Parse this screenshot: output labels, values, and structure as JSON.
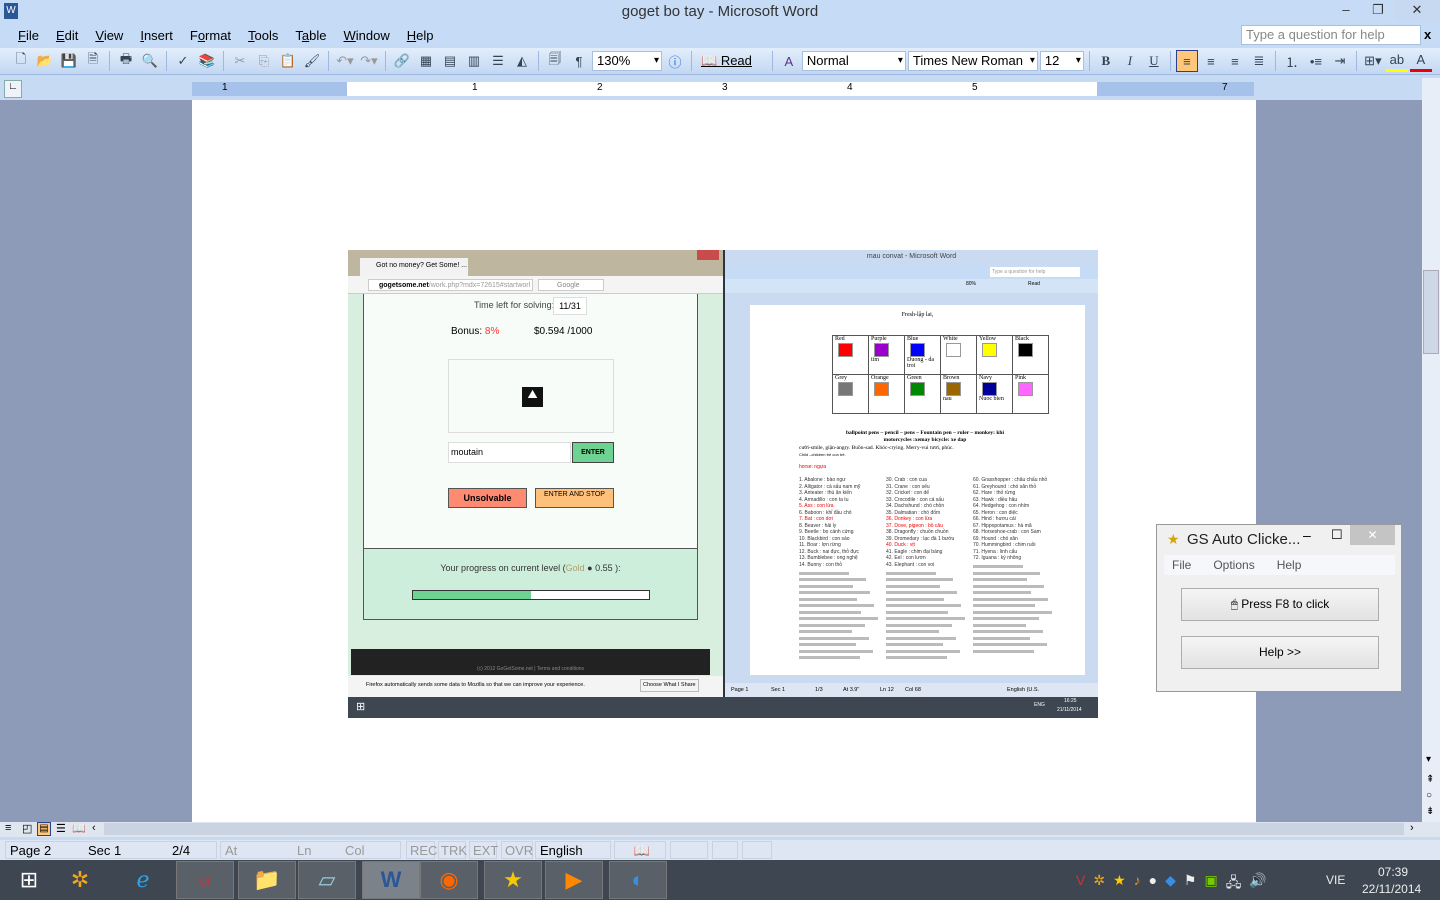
{
  "window": {
    "title": "goget bo tay - Microsoft Word",
    "help_placeholder": "Type a question for help",
    "close_doc": "x"
  },
  "menu": [
    {
      "key": "F",
      "rest": "ile"
    },
    {
      "key": "E",
      "rest": "dit"
    },
    {
      "key": "V",
      "rest": "iew"
    },
    {
      "key": "I",
      "rest": "nsert"
    },
    {
      "pre": "F",
      "key": "o",
      "rest": "rmat"
    },
    {
      "key": "T",
      "rest": "ools"
    },
    {
      "pre": "T",
      "key": "a",
      "rest": "ble"
    },
    {
      "key": "W",
      "rest": "indow"
    },
    {
      "key": "H",
      "rest": "elp"
    }
  ],
  "toolbar": {
    "zoom": "130%",
    "read": "Read",
    "style": "Normal",
    "font": "Times New Roman",
    "size": "12",
    "pilcrow": "¶"
  },
  "ruler": {
    "labels": [
      "1",
      "1",
      "2",
      "3",
      "4",
      "5",
      "7"
    ]
  },
  "status": {
    "page": "Page 2",
    "sec": "Sec 1",
    "pages": "2/4",
    "at": "At",
    "ln": "Ln",
    "col": "Col",
    "rec": "REC",
    "trk": "TRK",
    "ext": "EXT",
    "ovr": "OVR",
    "lang": "English (U.S."
  },
  "taskbar": {
    "lang": "VIE",
    "time": "07:39",
    "date": "22/11/2014",
    "apps": [
      "start-icon",
      "settings-app-icon",
      "internet-explorer-icon",
      "unikey-icon",
      "file-explorer-icon",
      "notepad-icon",
      "word-icon",
      "firefox-icon",
      "star-app-icon",
      "media-player-icon",
      "browser-globe-icon"
    ]
  },
  "embedded": {
    "firefox": {
      "tab": "Got no money? Get Some! ...",
      "url_host": "gogetsome.net",
      "url_path": "/work.php?mdx=72615#startworl",
      "search": "Google",
      "time_label": "Time left for solving:",
      "time_value": "11/31",
      "bonus_label": "Bonus:",
      "bonus_value": "8%",
      "money": "$0.594 /1000",
      "answer": "moutain",
      "enter": "ENTER",
      "unsolvable": "Unsolvable",
      "enter_stop": "ENTER AND STOP",
      "progress_prefix": "Your progress on current level (",
      "progress_level": "Gold",
      "progress_value": "0.55",
      "progress_suffix": "):",
      "progress_fraction": 0.5,
      "footer": "(c) 2012 GoGetSome.net  |  Terms and conditions",
      "notice": "Firefox automatically sends some data to Mozilla so that we can improve your experience.",
      "notice_btn": "Choose What I Share"
    },
    "word": {
      "title": "mau convat - Microsoft Word",
      "help": "Type a question for help",
      "zoom": "80%",
      "read": "Read",
      "size": "12",
      "heading": "Fresh-lập lai,",
      "colors": [
        {
          "name": "Red",
          "hex": "#ff0000",
          "note": ""
        },
        {
          "name": "Purple",
          "hex": "#9900cc",
          "note": "tim"
        },
        {
          "name": "Blue",
          "hex": "#0000ff",
          "note": "Duong - da troi"
        },
        {
          "name": "White",
          "hex": "#ffffff",
          "note": ""
        },
        {
          "name": "Yellow",
          "hex": "#ffff00",
          "note": ""
        },
        {
          "name": "Black",
          "hex": "#000000",
          "note": ""
        },
        {
          "name": "Grey",
          "hex": "#777777",
          "note": ""
        },
        {
          "name": "Orange",
          "hex": "#ff6600",
          "note": ""
        },
        {
          "name": "Green",
          "hex": "#008800",
          "note": ""
        },
        {
          "name": "Brown",
          "hex": "#996600",
          "note": "nau"
        },
        {
          "name": "Navy",
          "hex": "#000099",
          "note": "Nuoc bien"
        },
        {
          "name": "Pink",
          "hex": "#ff66ff",
          "note": ""
        }
      ],
      "line1": "ballpoint pens – pencil – pens – Fountain pen – ruler – monkey: khi",
      "line2": "motorcycles :xemay      bicycle: xe dap",
      "line3": "cười-smile, giận-angry. Buồn-sad. Khóc-crying. Merry-vui tươi, phúc.",
      "line4": "Child –children trẻ con trẻ.",
      "horse": "horse: ngựa",
      "col1": [
        "1. Abalone : bào ngư",
        "2. Alligator : cá sấu nam mỹ",
        "3. Anteater : thú ăn kiến",
        "4. Armadillo : con ta tu",
        "5. Ass : con lừa",
        "6. Baboon : khỉ đầu chó",
        "7. Bat : con dơi",
        "8. Beaver : hải ly",
        "9. Beetle : bọ cánh cứng",
        "10. Blackbird : con sáo",
        "11. Boar : lợn rừng",
        "12. Buck : nai đực, thỏ đực",
        "13. Bumblebee : ong nghệ",
        "14. Bunny : con thỏ"
      ],
      "col2": [
        "30. Crab : con cua",
        "31. Crane : con sếu",
        "32. Cricket : con dế",
        "33. Crocodile : con cá sấu",
        "34. Dachshund : chó chồn",
        "35. Dalmatian : chó đốm",
        "36. Donkey : con lừa",
        "37. Dove, pigeon : bồ câu",
        "38. Dragonfly : chuồn chuồn",
        "39. Dromedary : lạc đà 1 bướu",
        "40. Duck : vịt",
        "41. Eagle : chim đại bàng",
        "42. Eel : con lươn",
        "43. Elephant : con voi"
      ],
      "col3": [
        "60. Grasshopper : châu chấu nhỏ",
        "61. Greyhound : chó săn thỏ",
        "62. Hare : thỏ rừng",
        "63. Hawk : diều hâu",
        "64. Hedgehog : con nhím",
        "65. Heron : con diệc",
        "66. Hind : hươu cái",
        "67. Hippopotamus : hà mã",
        "68. Horseshoe-crab : con Sam",
        "69. Hound : chó săn",
        "70. Hummingbird : chim ruồi",
        "71. Hyena : linh cẩu",
        "72. Iguana : kỳ nhông"
      ],
      "red_items": [
        "5. Ass : con lừa",
        "7. Bat : con dơi",
        "36. Donkey : con lừa",
        "37. Dove, pigeon : bồ câu",
        "40. Duck : vịt"
      ],
      "status": {
        "page": "Page 1",
        "sec": "Sec 1",
        "pages": "1/3",
        "at": "At 3.9\"",
        "ln": "Ln 12",
        "col": "Col 68",
        "lang": "English (U.S."
      },
      "tray": {
        "lang": "ENG",
        "time": "16:25",
        "date": "21/11/2014"
      }
    }
  },
  "gs": {
    "title": "GS Auto Clicke...",
    "menu": [
      "File",
      "Options",
      "Help"
    ],
    "click_btn": "Press F8 to click",
    "help_btn": "Help >>"
  }
}
